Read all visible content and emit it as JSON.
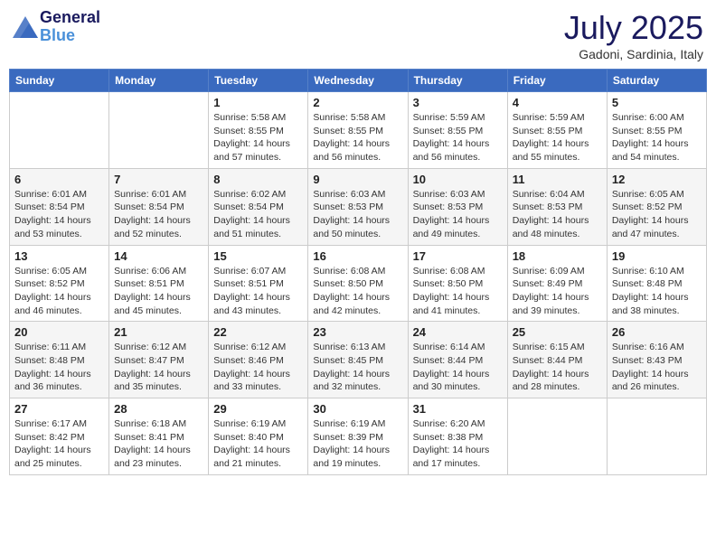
{
  "header": {
    "logo_line1": "General",
    "logo_line2": "Blue",
    "title": "July 2025",
    "subtitle": "Gadoni, Sardinia, Italy"
  },
  "weekdays": [
    "Sunday",
    "Monday",
    "Tuesday",
    "Wednesday",
    "Thursday",
    "Friday",
    "Saturday"
  ],
  "weeks": [
    [
      {
        "day": "",
        "detail": ""
      },
      {
        "day": "",
        "detail": ""
      },
      {
        "day": "1",
        "detail": "Sunrise: 5:58 AM\nSunset: 8:55 PM\nDaylight: 14 hours and 57 minutes."
      },
      {
        "day": "2",
        "detail": "Sunrise: 5:58 AM\nSunset: 8:55 PM\nDaylight: 14 hours and 56 minutes."
      },
      {
        "day": "3",
        "detail": "Sunrise: 5:59 AM\nSunset: 8:55 PM\nDaylight: 14 hours and 56 minutes."
      },
      {
        "day": "4",
        "detail": "Sunrise: 5:59 AM\nSunset: 8:55 PM\nDaylight: 14 hours and 55 minutes."
      },
      {
        "day": "5",
        "detail": "Sunrise: 6:00 AM\nSunset: 8:55 PM\nDaylight: 14 hours and 54 minutes."
      }
    ],
    [
      {
        "day": "6",
        "detail": "Sunrise: 6:01 AM\nSunset: 8:54 PM\nDaylight: 14 hours and 53 minutes."
      },
      {
        "day": "7",
        "detail": "Sunrise: 6:01 AM\nSunset: 8:54 PM\nDaylight: 14 hours and 52 minutes."
      },
      {
        "day": "8",
        "detail": "Sunrise: 6:02 AM\nSunset: 8:54 PM\nDaylight: 14 hours and 51 minutes."
      },
      {
        "day": "9",
        "detail": "Sunrise: 6:03 AM\nSunset: 8:53 PM\nDaylight: 14 hours and 50 minutes."
      },
      {
        "day": "10",
        "detail": "Sunrise: 6:03 AM\nSunset: 8:53 PM\nDaylight: 14 hours and 49 minutes."
      },
      {
        "day": "11",
        "detail": "Sunrise: 6:04 AM\nSunset: 8:53 PM\nDaylight: 14 hours and 48 minutes."
      },
      {
        "day": "12",
        "detail": "Sunrise: 6:05 AM\nSunset: 8:52 PM\nDaylight: 14 hours and 47 minutes."
      }
    ],
    [
      {
        "day": "13",
        "detail": "Sunrise: 6:05 AM\nSunset: 8:52 PM\nDaylight: 14 hours and 46 minutes."
      },
      {
        "day": "14",
        "detail": "Sunrise: 6:06 AM\nSunset: 8:51 PM\nDaylight: 14 hours and 45 minutes."
      },
      {
        "day": "15",
        "detail": "Sunrise: 6:07 AM\nSunset: 8:51 PM\nDaylight: 14 hours and 43 minutes."
      },
      {
        "day": "16",
        "detail": "Sunrise: 6:08 AM\nSunset: 8:50 PM\nDaylight: 14 hours and 42 minutes."
      },
      {
        "day": "17",
        "detail": "Sunrise: 6:08 AM\nSunset: 8:50 PM\nDaylight: 14 hours and 41 minutes."
      },
      {
        "day": "18",
        "detail": "Sunrise: 6:09 AM\nSunset: 8:49 PM\nDaylight: 14 hours and 39 minutes."
      },
      {
        "day": "19",
        "detail": "Sunrise: 6:10 AM\nSunset: 8:48 PM\nDaylight: 14 hours and 38 minutes."
      }
    ],
    [
      {
        "day": "20",
        "detail": "Sunrise: 6:11 AM\nSunset: 8:48 PM\nDaylight: 14 hours and 36 minutes."
      },
      {
        "day": "21",
        "detail": "Sunrise: 6:12 AM\nSunset: 8:47 PM\nDaylight: 14 hours and 35 minutes."
      },
      {
        "day": "22",
        "detail": "Sunrise: 6:12 AM\nSunset: 8:46 PM\nDaylight: 14 hours and 33 minutes."
      },
      {
        "day": "23",
        "detail": "Sunrise: 6:13 AM\nSunset: 8:45 PM\nDaylight: 14 hours and 32 minutes."
      },
      {
        "day": "24",
        "detail": "Sunrise: 6:14 AM\nSunset: 8:44 PM\nDaylight: 14 hours and 30 minutes."
      },
      {
        "day": "25",
        "detail": "Sunrise: 6:15 AM\nSunset: 8:44 PM\nDaylight: 14 hours and 28 minutes."
      },
      {
        "day": "26",
        "detail": "Sunrise: 6:16 AM\nSunset: 8:43 PM\nDaylight: 14 hours and 26 minutes."
      }
    ],
    [
      {
        "day": "27",
        "detail": "Sunrise: 6:17 AM\nSunset: 8:42 PM\nDaylight: 14 hours and 25 minutes."
      },
      {
        "day": "28",
        "detail": "Sunrise: 6:18 AM\nSunset: 8:41 PM\nDaylight: 14 hours and 23 minutes."
      },
      {
        "day": "29",
        "detail": "Sunrise: 6:19 AM\nSunset: 8:40 PM\nDaylight: 14 hours and 21 minutes."
      },
      {
        "day": "30",
        "detail": "Sunrise: 6:19 AM\nSunset: 8:39 PM\nDaylight: 14 hours and 19 minutes."
      },
      {
        "day": "31",
        "detail": "Sunrise: 6:20 AM\nSunset: 8:38 PM\nDaylight: 14 hours and 17 minutes."
      },
      {
        "day": "",
        "detail": ""
      },
      {
        "day": "",
        "detail": ""
      }
    ]
  ]
}
